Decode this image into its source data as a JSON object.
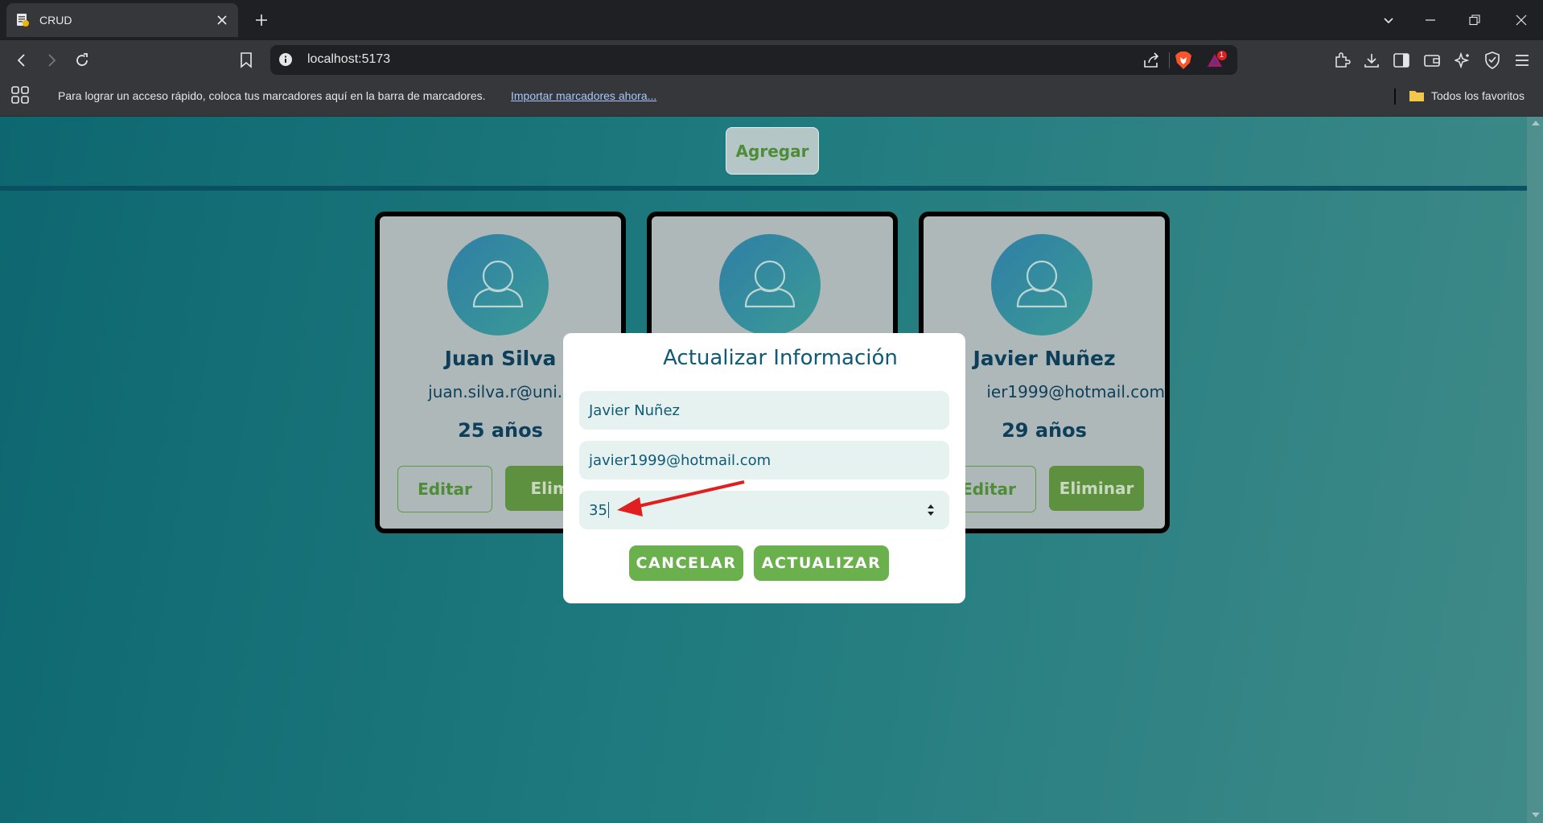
{
  "browser": {
    "tab_title": "CRUD",
    "url": "localhost:5173",
    "bookmarks_prompt": "Para lograr un acceso rápido, coloca tus marcadores aquí en la barra de marcadores.",
    "bookmarks_import_link": "Importar marcadores ahora...",
    "all_favorites": "Todos los favoritos",
    "rewards_badge": "1",
    "icons": [
      "back-icon",
      "forward-icon",
      "reload-icon",
      "bookmark-icon",
      "info-icon",
      "share-icon",
      "brave-shields-icon",
      "brave-rewards-icon",
      "extensions-icon",
      "download-icon",
      "sidebar-icon",
      "wallet-icon",
      "leo-ai-icon",
      "vpn-icon",
      "menu-icon",
      "apps-icon",
      "folder-icon"
    ]
  },
  "page": {
    "add_button": "Agregar",
    "cards": [
      {
        "name": "Juan Silva",
        "email": "juan.silva.r@uni.p",
        "age": "25 años",
        "edit": "Editar",
        "delete": "Elimi"
      },
      {
        "name": "",
        "email": "",
        "age": "",
        "edit": "",
        "delete": ""
      },
      {
        "name": "Javier Nuñez",
        "email": "ier1999@hotmail.com",
        "age": "29 años",
        "edit": "Editar",
        "delete": "Eliminar"
      }
    ]
  },
  "modal": {
    "title": "Actualizar Información",
    "name_value": "Javier Nuñez",
    "email_value": "javier1999@hotmail.com",
    "age_value": "35",
    "cancel_label": "CANCELAR",
    "update_label": "ACTUALIZAR"
  },
  "colors": {
    "accent_green": "#6ab04c",
    "dark_green": "#5d913f",
    "text_teal": "#0f5a78",
    "annotation_red": "#e02020"
  }
}
